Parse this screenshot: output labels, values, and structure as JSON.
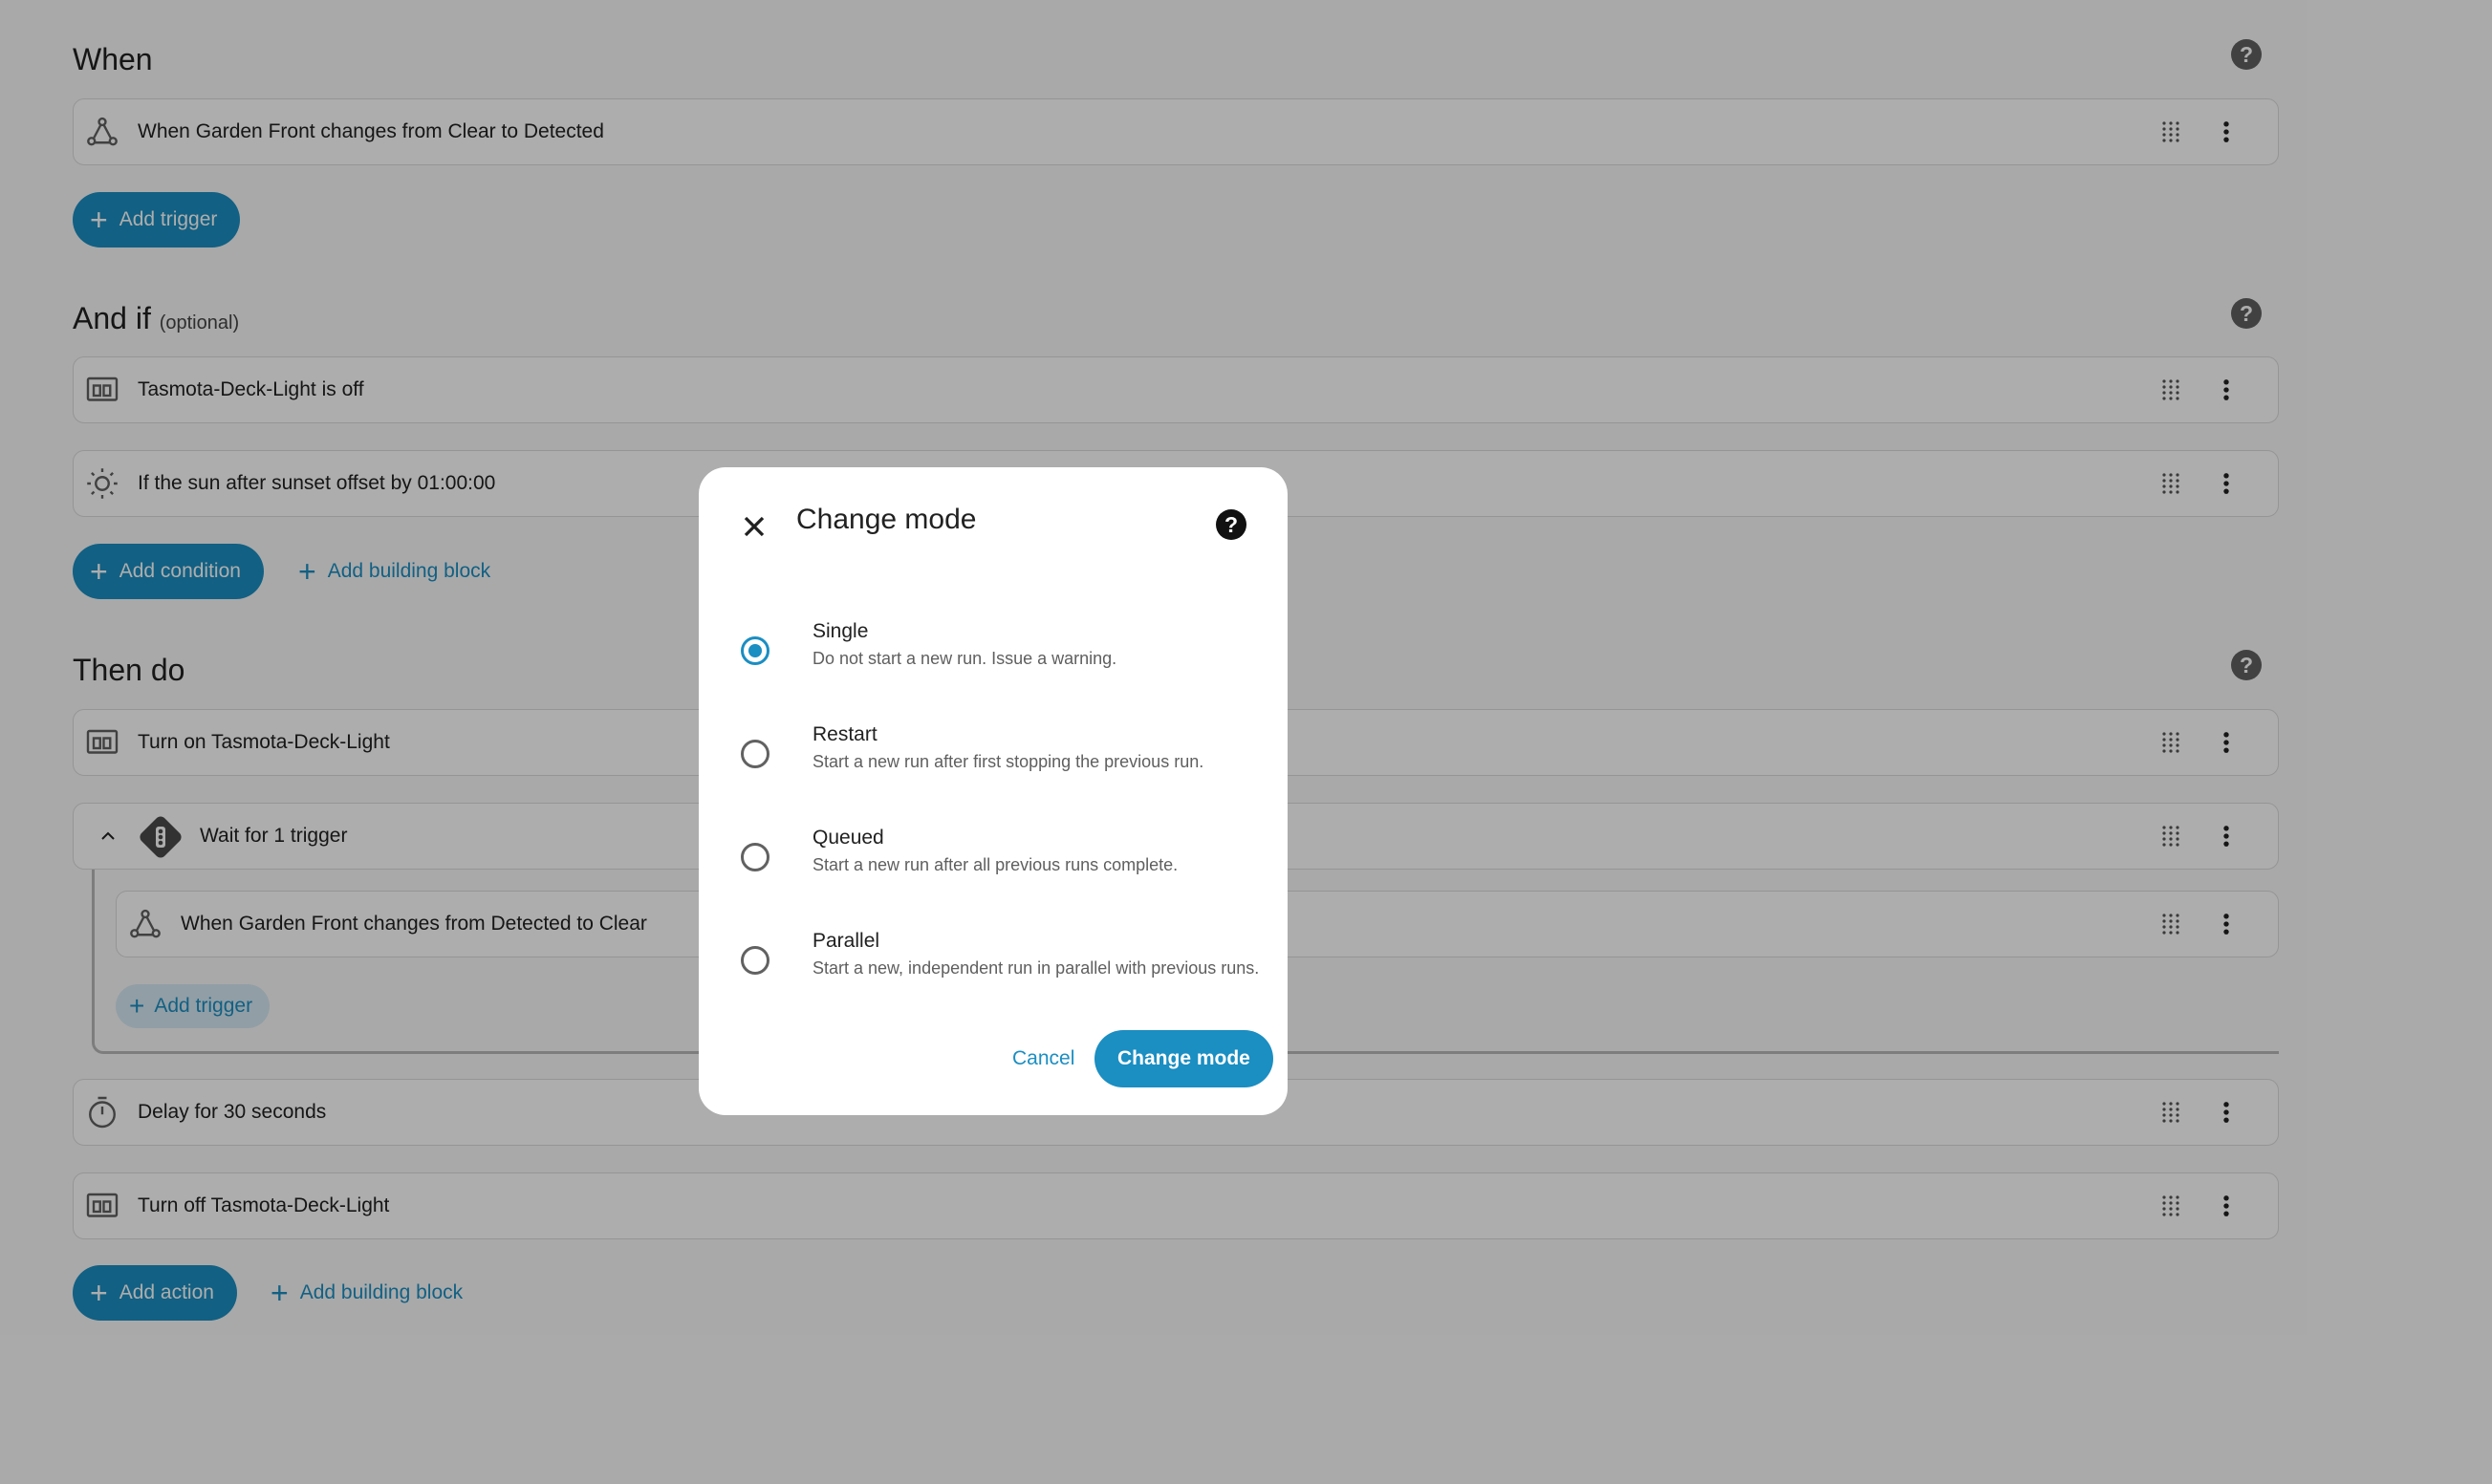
{
  "sections": {
    "when": {
      "title": "When"
    },
    "and_if": {
      "title": "And if",
      "optional": "(optional)"
    },
    "then_do": {
      "title": "Then do"
    }
  },
  "help_glyph": "?",
  "triggers": [
    {
      "label": "When Garden Front changes from Clear to Detected",
      "icon": "trigger-icon"
    }
  ],
  "conditions": [
    {
      "label": "Tasmota-Deck-Light is off",
      "icon": "device-icon"
    },
    {
      "label": "If the sun after sunset offset by 01:00:00",
      "icon": "sun-icon"
    }
  ],
  "actions": [
    {
      "label": "Turn on Tasmota-Deck-Light",
      "icon": "device-icon"
    },
    {
      "label": "Wait for 1 trigger",
      "icon": "traffic-light-icon"
    },
    {
      "label": "When Garden Front changes from Detected to Clear",
      "icon": "trigger-icon"
    },
    {
      "label": "Delay for 30 seconds",
      "icon": "timer-icon"
    },
    {
      "label": "Turn off Tasmota-Deck-Light",
      "icon": "device-icon"
    }
  ],
  "buttons": {
    "plus": "+",
    "add_trigger": "Add trigger",
    "add_condition": "Add condition",
    "add_building_block": "Add building block",
    "add_nested_trigger": "Add trigger",
    "add_action": "Add action",
    "add_building_block_2": "Add building block"
  },
  "dialog": {
    "title": "Change mode",
    "options": [
      {
        "name": "Single",
        "desc": "Do not start a new run. Issue a warning.",
        "selected": true
      },
      {
        "name": "Restart",
        "desc": "Start a new run after first stopping the previous run.",
        "selected": false
      },
      {
        "name": "Queued",
        "desc": "Start a new run after all previous runs complete.",
        "selected": false
      },
      {
        "name": "Parallel",
        "desc": "Start a new, independent run in parallel with previous runs.",
        "selected": false
      }
    ],
    "cancel": "Cancel",
    "confirm": "Change mode"
  },
  "colors": {
    "accent": "#1b8ec2",
    "scrim": "rgba(0,0,0,0.32)"
  }
}
